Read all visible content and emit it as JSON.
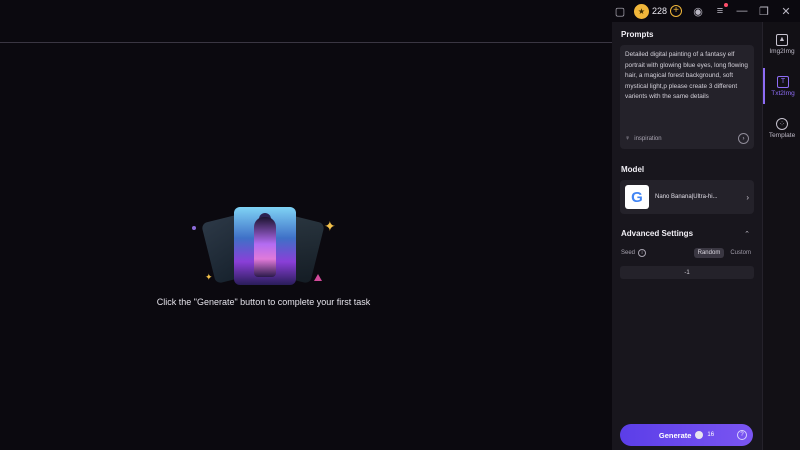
{
  "titlebar": {
    "credits": "228",
    "icons": [
      "window-icon",
      "coin-icon",
      "add-credits-icon",
      "user-icon",
      "menu-icon",
      "minimize-icon",
      "restore-icon",
      "close-icon"
    ]
  },
  "canvas": {
    "hint": "Click the \"Generate\" button to complete your first task"
  },
  "panel": {
    "prompts_title": "Prompts",
    "prompt_text": "Detailed digital painting of a fantasy elf portrait with glowing blue eyes, long flowing hair, a magical forest background, soft mystical light,p please create 3 different varients with the same details",
    "inspiration_label": "inspiration",
    "model_title": "Model",
    "model_name": "Nano Banana|Ultra-hi...",
    "advanced_title": "Advanced Settings",
    "seed_label": "Seed",
    "seed_random": "Random",
    "seed_custom": "Custom",
    "seed_value": "-1",
    "generate_label": "Generate",
    "generate_cost": "16"
  },
  "rail": {
    "items": [
      {
        "label": "Img2Img"
      },
      {
        "label": "Txt2Img"
      },
      {
        "label": "Template"
      }
    ]
  },
  "colors": {
    "accent": "#7a55f2",
    "background": "#0b090f",
    "panel": "#18161d",
    "coin": "#f0b63a"
  }
}
